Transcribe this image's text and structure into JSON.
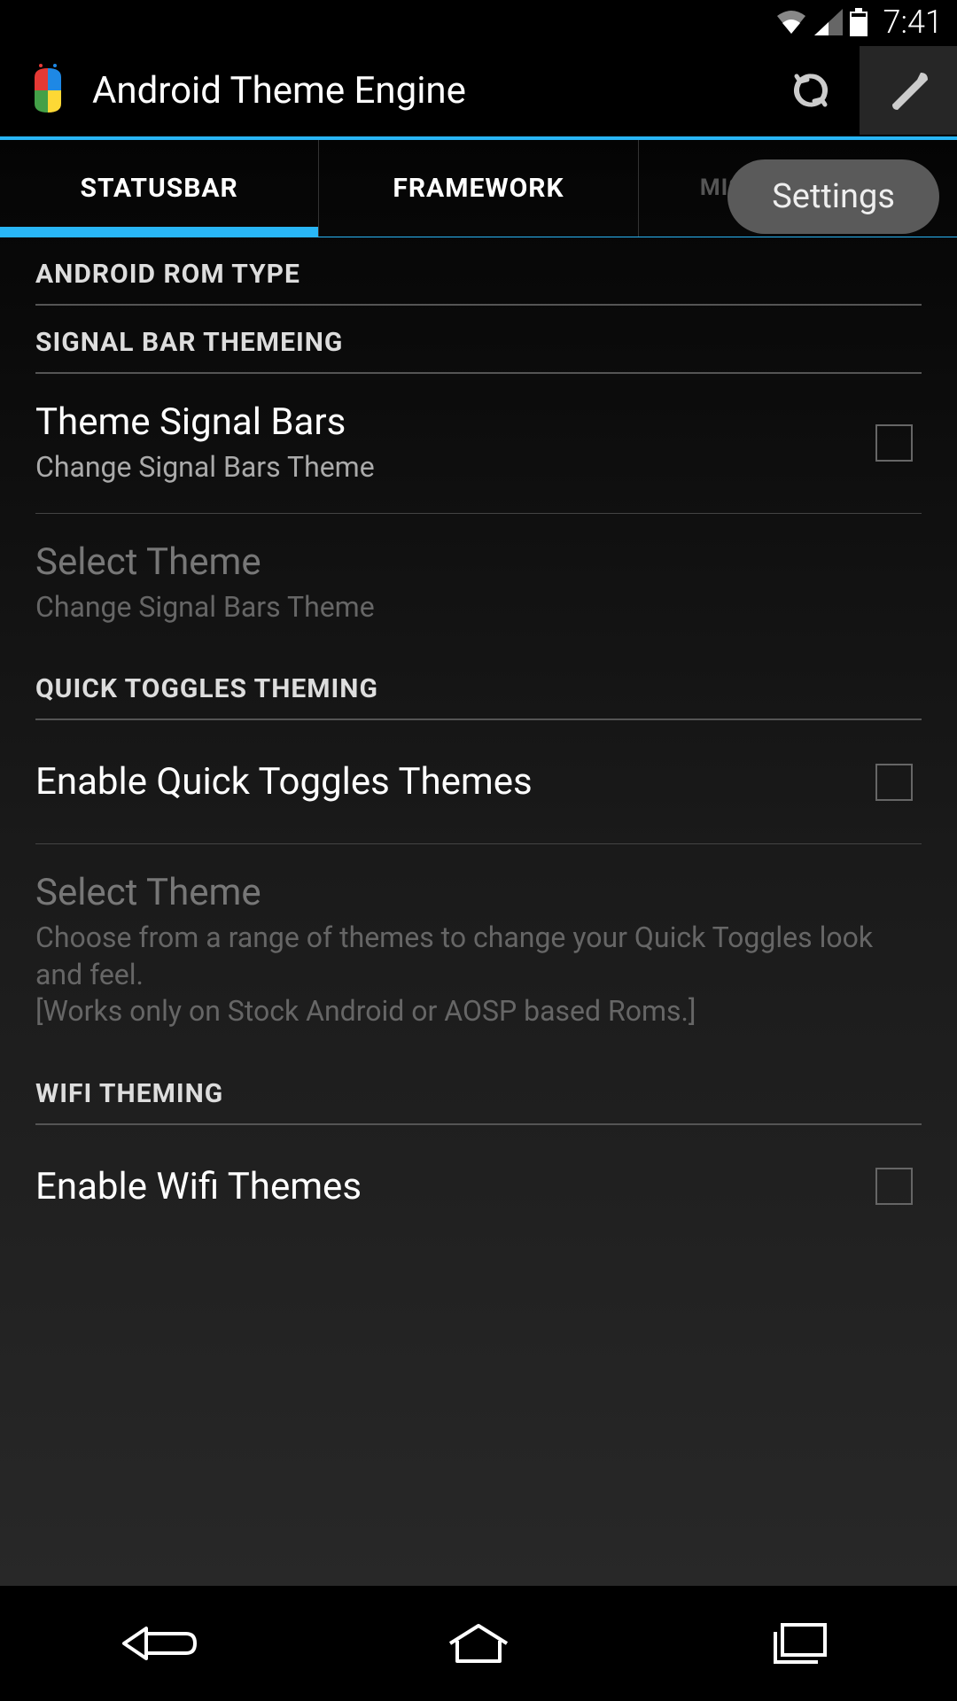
{
  "statusbar": {
    "time": "7:41"
  },
  "actionbar": {
    "title": "Android Theme Engine",
    "tooltip": "Settings"
  },
  "tabs": {
    "statusbar": "STATUSBAR",
    "framework": "FRAMEWORK",
    "misc": "MISCELLANEOUS"
  },
  "sections": {
    "rom_type": "ANDROID ROM TYPE",
    "signal_bar": "SIGNAL BAR THEMEING",
    "quick_toggles": "QUICK TOGGLES THEMING",
    "wifi": "WIFI THEMING"
  },
  "items": {
    "theme_signal_bars": {
      "title": "Theme Signal Bars",
      "subtitle": "Change Signal Bars Theme"
    },
    "select_theme_signal": {
      "title": "Select Theme",
      "subtitle": "Change Signal Bars Theme"
    },
    "enable_quick_toggles": {
      "title": "Enable Quick Toggles Themes"
    },
    "select_theme_toggles": {
      "title": "Select Theme",
      "subtitle": "Choose from a range of themes to change your Quick Toggles look and feel.\n[Works only on Stock Android or AOSP based Roms.]"
    },
    "enable_wifi": {
      "title": "Enable Wifi Themes"
    }
  }
}
